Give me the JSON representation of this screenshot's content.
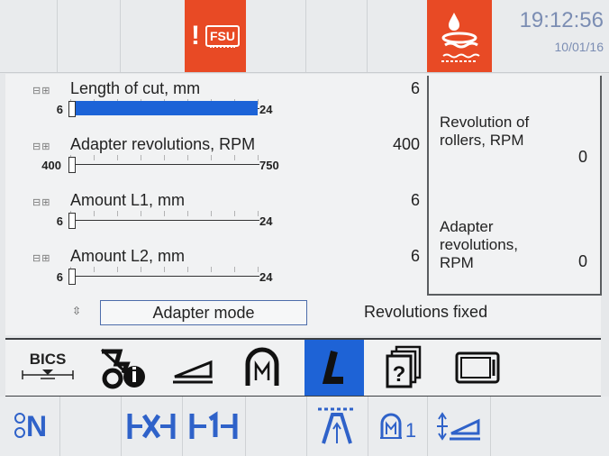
{
  "topbar": {
    "fsu_label": "FSU",
    "time": "19:12:56",
    "date": "10/01/16"
  },
  "params": [
    {
      "label": "Length of cut, mm",
      "value": "6",
      "min": "6",
      "max": "24",
      "slider_level": 1.0
    },
    {
      "label": "Adapter revolutions, RPM",
      "value": "400",
      "min": "400",
      "max": "750",
      "slider_level": 0.0
    },
    {
      "label": "Amount L1, mm",
      "value": "6",
      "min": "6",
      "max": "24",
      "slider_level": 0.0
    },
    {
      "label": "Amount L2, mm",
      "value": "6",
      "min": "6",
      "max": "24",
      "slider_level": 0.0
    }
  ],
  "info": {
    "rollers_label": "Revolution of rollers, RPM",
    "rollers_value": "0",
    "adapter_label": "Adapter revolutions, RPM",
    "adapter_value": "0"
  },
  "mode": {
    "button_label": "Adapter mode",
    "status": "Revolutions fixed"
  },
  "iconbar": {
    "bics_label": "BICS",
    "selected": "L-icon",
    "items": [
      "bics-icon",
      "tool-info-icon",
      "wedge-icon",
      "m-arch-icon",
      "L-icon",
      "help-pages-icon",
      "screen-icon"
    ]
  },
  "bottombar": {
    "n_label": "N",
    "counter_label": "1"
  },
  "colors": {
    "accent_red": "#e84a25",
    "selection_blue": "#1e63d6",
    "icon_blue": "#2f62c9"
  }
}
